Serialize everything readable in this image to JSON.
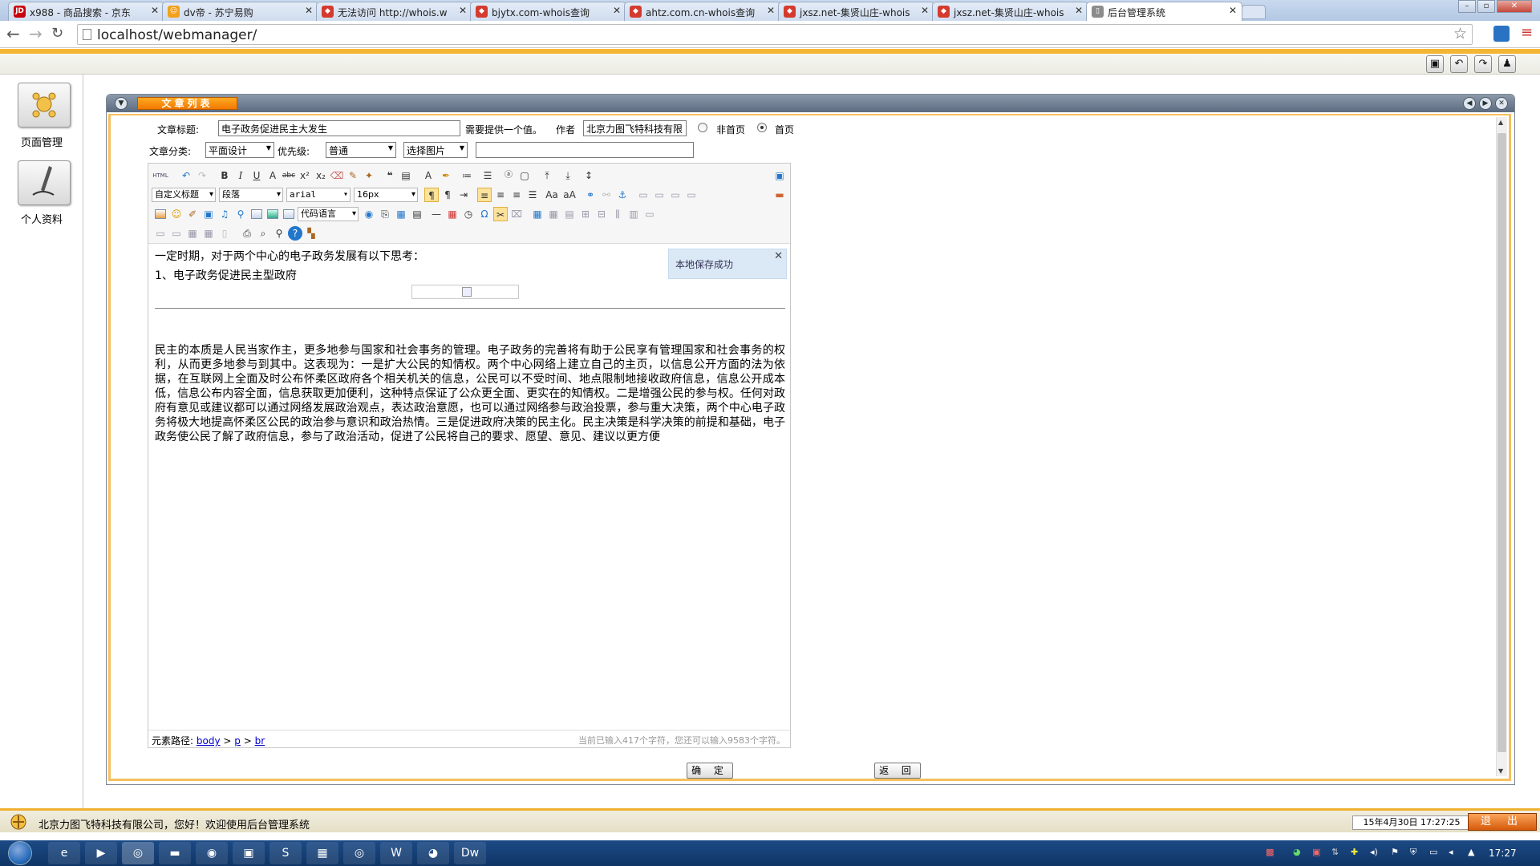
{
  "browser": {
    "tabs": [
      {
        "label": "x988 - 商品搜索 - 京东",
        "fav": "JD",
        "fav_color": "#c7000b"
      },
      {
        "label": "dv帝 - 苏宁易购",
        "fav": "☺",
        "fav_color": "#f3a01a"
      },
      {
        "label": "无法访问 http://whois.w",
        "fav": "◆",
        "fav_color": "#d43b2e"
      },
      {
        "label": "bjytx.com-whois查询",
        "fav": "◆",
        "fav_color": "#d43b2e"
      },
      {
        "label": "ahtz.com.cn-whois查询",
        "fav": "◆",
        "fav_color": "#d43b2e"
      },
      {
        "label": "jxsz.net-集贤山庄-whois",
        "fav": "◆",
        "fav_color": "#d43b2e"
      },
      {
        "label": "jxsz.net-集贤山庄-whois",
        "fav": "◆",
        "fav_color": "#d43b2e"
      },
      {
        "label": "后台管理系统",
        "fav": "▯",
        "fav_color": "#8c8c8c"
      }
    ],
    "url": "localhost/webmanager/"
  },
  "nav": {
    "items": [
      {
        "label": "页面管理",
        "icon": "page-manage-icon"
      },
      {
        "label": "个人资料",
        "icon": "profile-pen-icon"
      }
    ]
  },
  "window": {
    "title": "文章列表"
  },
  "form": {
    "title_label": "文章标题:",
    "title_value": "电子政务促进民主大发生",
    "title_hint": "需要提供一个值。",
    "author_label": "作者",
    "author_value": "北京力图飞特科技有限",
    "radio_not_home": "非首页",
    "radio_home": "首页",
    "category_label": "文章分类:",
    "category_value": "平面设计",
    "priority_label": "优先级:",
    "priority_value": "普通",
    "image_select": "选择图片",
    "image_path": ""
  },
  "editor": {
    "toolbar": {
      "heading": "自定义标题",
      "paragraph": "段落",
      "font": "arial",
      "size": "16px",
      "code_lang": "代码语言",
      "html_label": "HTML"
    },
    "toast": "本地保存成功",
    "line1": "一定时期，对于两个中心的电子政务发展有以下思考：",
    "line2": "1、电子政务促进民主型政府",
    "paragraph": "民主的本质是人民当家作主，更多地参与国家和社会事务的管理。电子政务的完善将有助于公民享有管理国家和社会事务的权利，从而更多地参与到其中。这表现为：一是扩大公民的知情权。两个中心网络上建立自己的主页，以信息公开方面的法为依据，在互联网上全面及时公布怀柔区政府各个相关机关的信息，公民可以不受时间、地点限制地接收政府信息，信息公开成本低，信息公布内容全面，信息获取更加便利，这种特点保证了公众更全面、更实在的知情权。二是增强公民的参与权。任何对政府有意见或建议都可以通过网络发展政治观点，表达政治意愿，也可以通过网络参与政治投票，参与重大决策，两个中心电子政务将极大地提高怀柔区公民的政治参与意识和政治热情。三是促进政府决策的民主化。民主决策是科学决策的前提和基础，电子政务使公民了解了政府信息，参与了政治活动，促进了公民将自己的要求、愿望、意见、建议以更方便",
    "path_label": "元素路径:",
    "path_body": "body",
    "path_p": "p",
    "path_br": "br",
    "path_sep": ">",
    "word_count": "当前已输入417个字符，您还可以输入9583个字符。"
  },
  "buttons": {
    "confirm": "确 定",
    "back": "返 回"
  },
  "footer": {
    "welcome": "北京力图飞特科技有限公司，您好！欢迎使用后台管理系统",
    "datetime": "15年4月30日 17:27:25",
    "logout": "退 出"
  },
  "taskbar": {
    "clock": "17:27"
  }
}
